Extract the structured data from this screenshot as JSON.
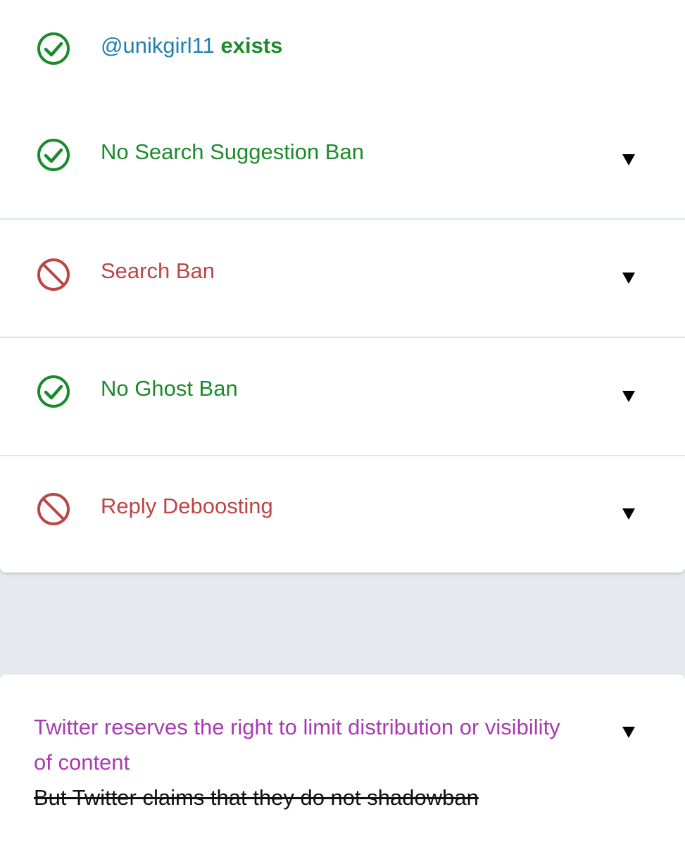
{
  "results": {
    "username": "@unikgirl11",
    "exists_suffix": " exists",
    "items": [
      {
        "label": "No Search Suggestion Ban",
        "status": "pass",
        "icon": "check-circle-icon"
      },
      {
        "label": "Search Ban",
        "status": "fail",
        "icon": "ban-icon"
      },
      {
        "label": "No Ghost Ban",
        "status": "pass",
        "icon": "check-circle-icon"
      },
      {
        "label": "Reply Deboosting",
        "status": "fail",
        "icon": "ban-icon"
      }
    ]
  },
  "info": {
    "headline": "Twitter reserves the right to limit distribution or visibility of content",
    "claim": "But Twitter claims that they do not shadowban"
  },
  "colors": {
    "pass": "#1c8a2b",
    "fail": "#bc4545",
    "username": "#1f7fb3",
    "info": "#a93bb1",
    "claim": "#111111",
    "background": "#e6eaee",
    "card": "#ffffff"
  }
}
